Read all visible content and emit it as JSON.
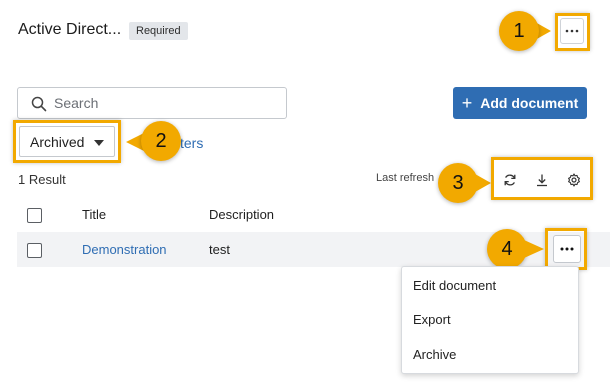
{
  "header": {
    "title": "Active Direct...",
    "badge": "Required"
  },
  "search": {
    "placeholder": "Search"
  },
  "toolbar": {
    "add_label": "Add document",
    "filter_selected": "Archived",
    "filters_link": "ters",
    "result_count": "1 Result",
    "last_refresh": "Last refresh"
  },
  "table": {
    "columns": [
      "Title",
      "Description"
    ],
    "rows": [
      {
        "title": "Demonstration",
        "description": "test"
      }
    ]
  },
  "row_menu": {
    "items": [
      "Edit document",
      "Export",
      "Archive"
    ]
  },
  "callouts": [
    "1",
    "2",
    "3",
    "4"
  ],
  "colors": {
    "accent": "#2f6db3",
    "callout": "#f2a900",
    "row_bg": "#f2f3f5"
  },
  "icons": [
    "search-icon",
    "plus-icon",
    "ellipsis-icon",
    "refresh-icon",
    "download-icon",
    "gear-icon",
    "caret-down-icon"
  ]
}
